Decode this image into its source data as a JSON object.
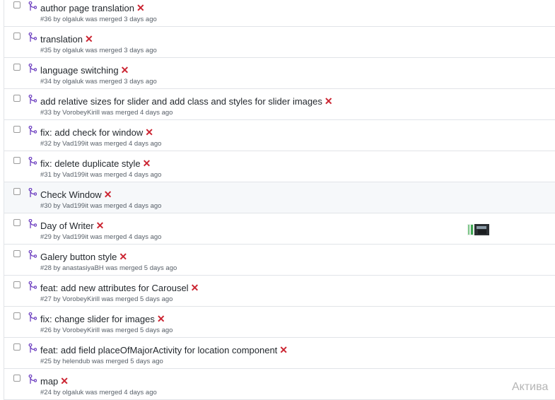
{
  "pull_requests": [
    {
      "title": "author page translation",
      "meta": "#36 by olgaluk was merged 3 days ago"
    },
    {
      "title": "translation",
      "meta": "#35 by olgaluk was merged 3 days ago"
    },
    {
      "title": "language switching",
      "meta": "#34 by olgaluk was merged 3 days ago"
    },
    {
      "title": "add relative sizes for slider and add class and styles for slider images",
      "meta": "#33 by VorobeyKirill was merged 4 days ago"
    },
    {
      "title": "fix: add check for window",
      "meta": "#32 by Vad199it was merged 4 days ago"
    },
    {
      "title": "fix: delete duplicate style",
      "meta": "#31 by Vad199it was merged 4 days ago"
    },
    {
      "title": "Check Window",
      "meta": "#30 by Vad199it was merged 4 days ago"
    },
    {
      "title": "Day of Writer",
      "meta": "#29 by Vad199it was merged 4 days ago"
    },
    {
      "title": "Galery button style",
      "meta": "#28 by anastasiyaBH was merged 5 days ago"
    },
    {
      "title": "feat: add new attributes for Carousel",
      "meta": "#27 by VorobeyKirill was merged 5 days ago"
    },
    {
      "title": "fix: change slider for images",
      "meta": "#26 by VorobeyKirill was merged 5 days ago"
    },
    {
      "title": "feat: add field placeOfMajorActivity for location component",
      "meta": "#25 by helendub was merged 5 days ago"
    },
    {
      "title": "map",
      "meta": "#24 by olgaluk was merged 4 days ago"
    }
  ],
  "status_icon": "x-mark-icon",
  "status_glyph": "✕",
  "status_color": "#cb2431",
  "merged_icon": "git-merge-icon",
  "merged_color": "#6f42c1",
  "watermark": "Актива"
}
